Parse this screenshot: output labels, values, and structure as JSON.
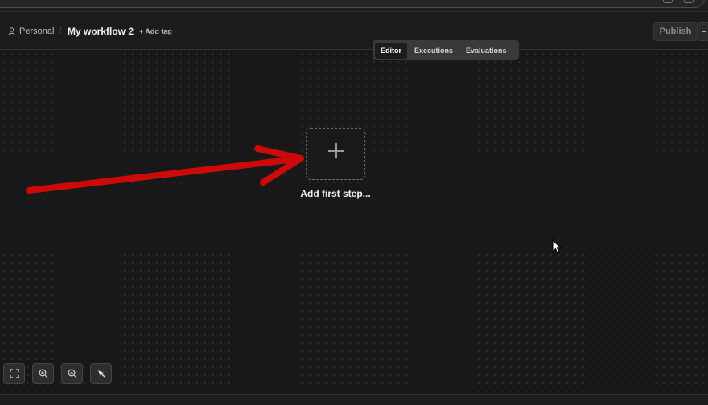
{
  "header": {
    "project_label": "Personal",
    "separator": "/",
    "workflow_name": "My workflow 2",
    "add_tag_label": "+ Add tag",
    "publish_label": "Publish"
  },
  "tabs": [
    {
      "label": "Editor",
      "active": true
    },
    {
      "label": "Executions",
      "active": false
    },
    {
      "label": "Evaluations",
      "active": false
    }
  ],
  "canvas": {
    "add_first_step_label": "Add first step..."
  },
  "controls": {
    "icons": [
      "fit-view-icon",
      "zoom-in-icon",
      "zoom-out-icon",
      "tidy-up-icon"
    ]
  },
  "colors": {
    "background": "#1a1a1a",
    "annotation_arrow": "#cc0a0a",
    "tab_switcher": "#3a3a3a"
  }
}
